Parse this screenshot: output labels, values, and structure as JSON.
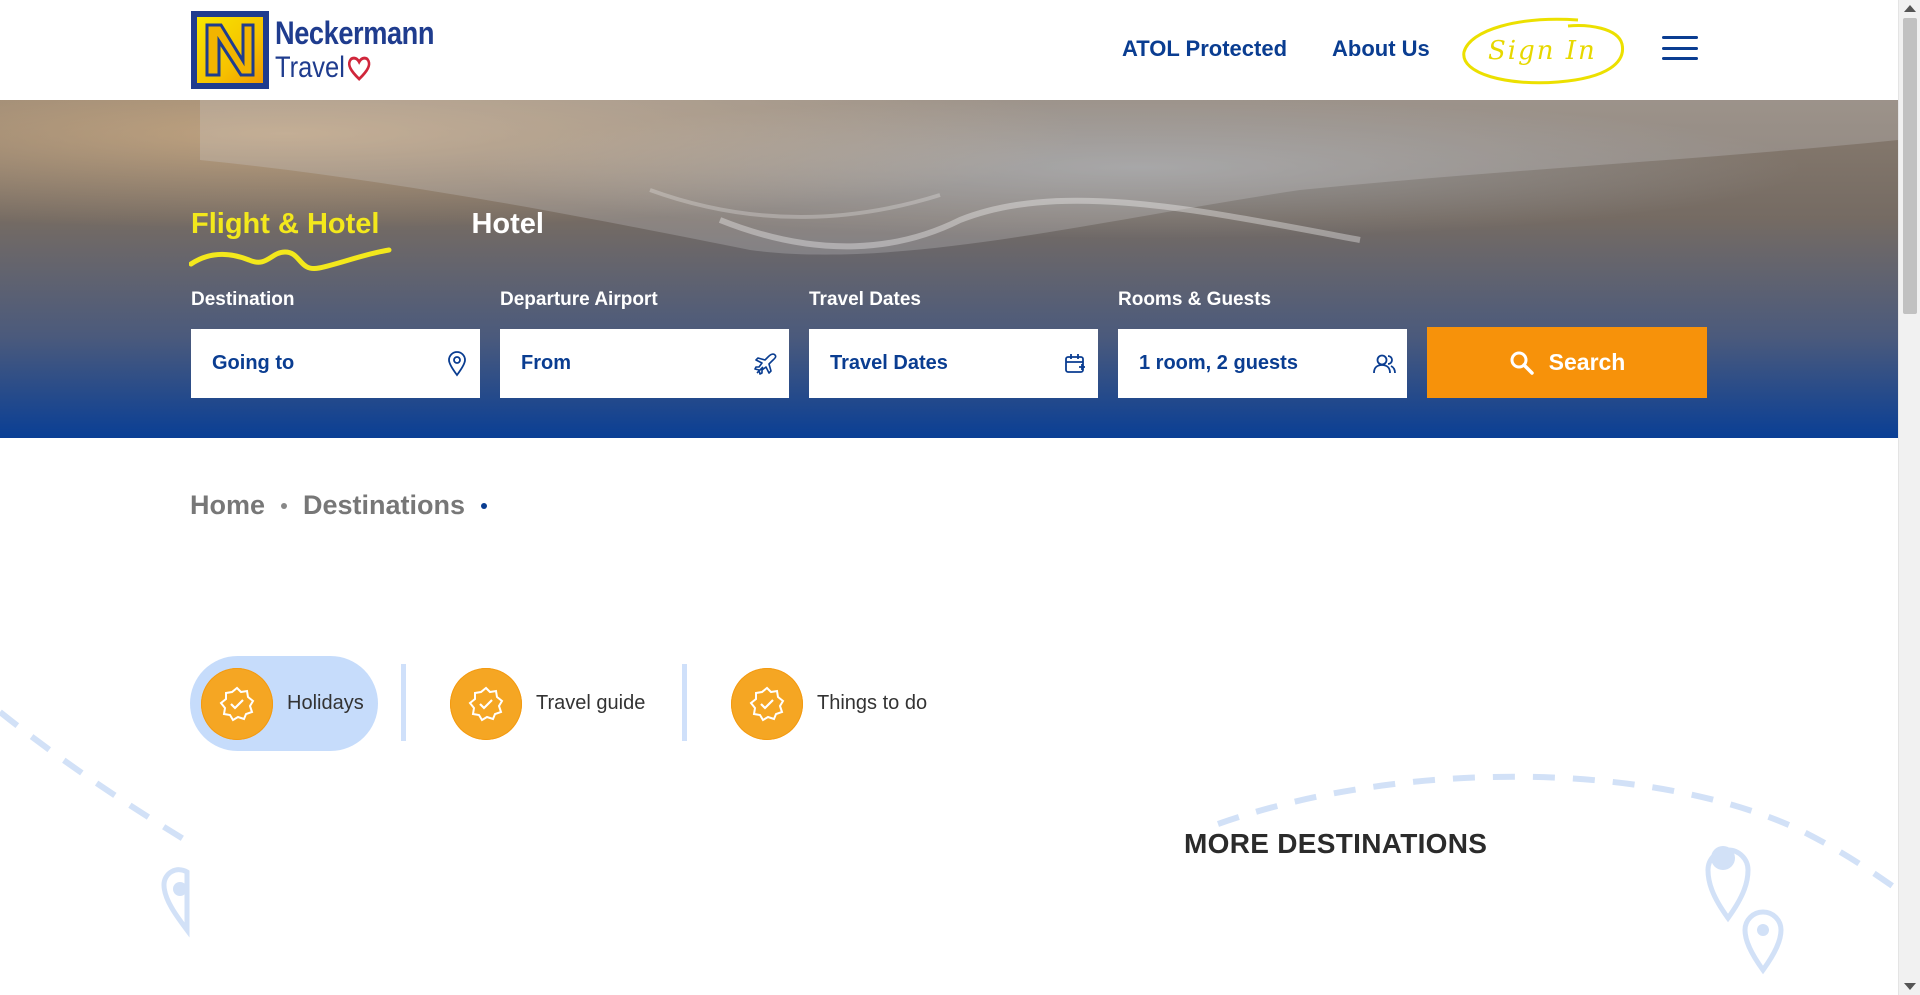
{
  "header": {
    "logo": {
      "line1": "Neckermann",
      "line2": "Travel"
    },
    "nav": {
      "atol": "ATOL Protected",
      "about": "About Us",
      "signin": "Sign In"
    }
  },
  "search": {
    "tabs": [
      {
        "label": "Flight & Hotel",
        "active": true
      },
      {
        "label": "Hotel",
        "active": false
      }
    ],
    "fields": [
      {
        "label": "Destination",
        "value": "Going to",
        "icon": "location-pin-icon"
      },
      {
        "label": "Departure Airport",
        "value": "From",
        "icon": "airplane-icon"
      },
      {
        "label": "Travel Dates",
        "value": "Travel Dates",
        "icon": "calendar-icon"
      },
      {
        "label": "Rooms & Guests",
        "value": "1 room, 2 guests",
        "icon": "guests-icon"
      }
    ],
    "button": "Search"
  },
  "breadcrumb": {
    "items": [
      "Home",
      "Destinations"
    ]
  },
  "categories": [
    {
      "label": "Holidays",
      "active": true
    },
    {
      "label": "Travel guide",
      "active": false
    },
    {
      "label": "Things to do",
      "active": false
    }
  ],
  "more_destinations": "MORE DESTINATIONS",
  "colors": {
    "brand_blue": "#0a3d91",
    "accent_orange": "#f7920a",
    "accent_yellow": "#f3e81c"
  }
}
